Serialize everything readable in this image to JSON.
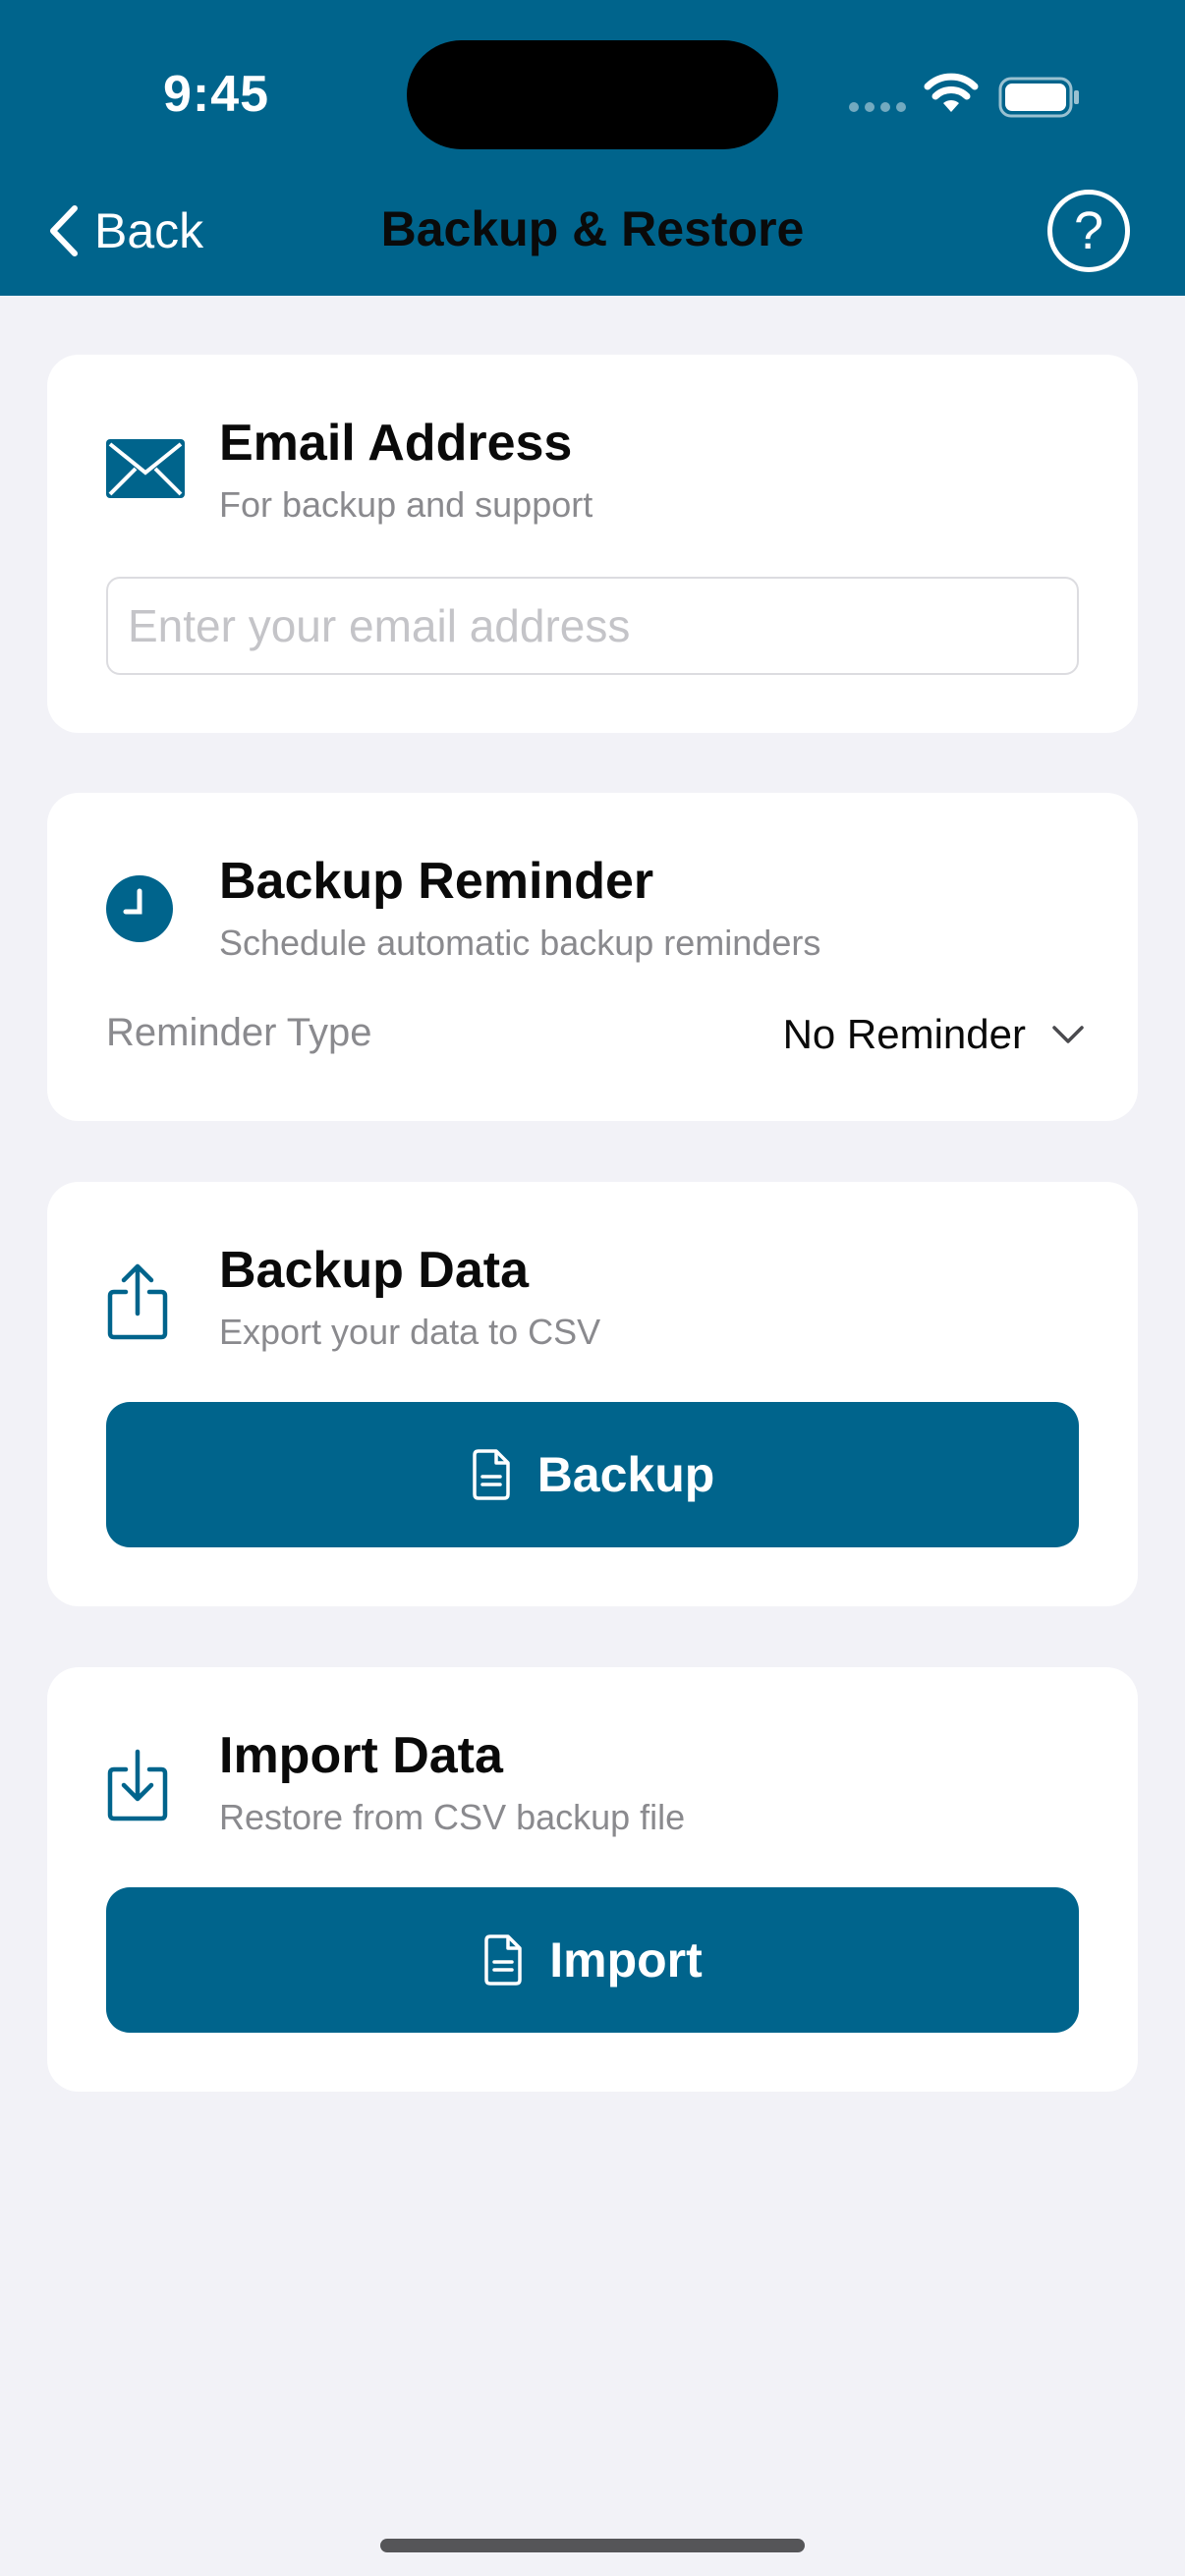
{
  "status_bar": {
    "time": "9:45"
  },
  "nav": {
    "back_label": "Back",
    "title": "Backup & Restore",
    "help_label": "?"
  },
  "email_card": {
    "icon": "envelope-icon",
    "title": "Email Address",
    "subtitle": "For backup and support",
    "input_value": "",
    "input_placeholder": "Enter your email address"
  },
  "reminder_card": {
    "icon": "clock-icon",
    "title": "Backup Reminder",
    "subtitle": "Schedule automatic backup reminders",
    "field_label": "Reminder Type",
    "selected_value": "No Reminder"
  },
  "backup_card": {
    "icon": "share-upload-icon",
    "title": "Backup Data",
    "subtitle": "Export your data to CSV",
    "button_label": "Backup",
    "button_icon": "document-icon"
  },
  "import_card": {
    "icon": "download-tray-icon",
    "title": "Import Data",
    "subtitle": "Restore from CSV backup file",
    "button_label": "Import",
    "button_icon": "document-icon"
  },
  "colors": {
    "brand": "#00648c",
    "background": "#f2f2f7",
    "card": "#ffffff",
    "secondary_text": "#8a8a8e"
  }
}
